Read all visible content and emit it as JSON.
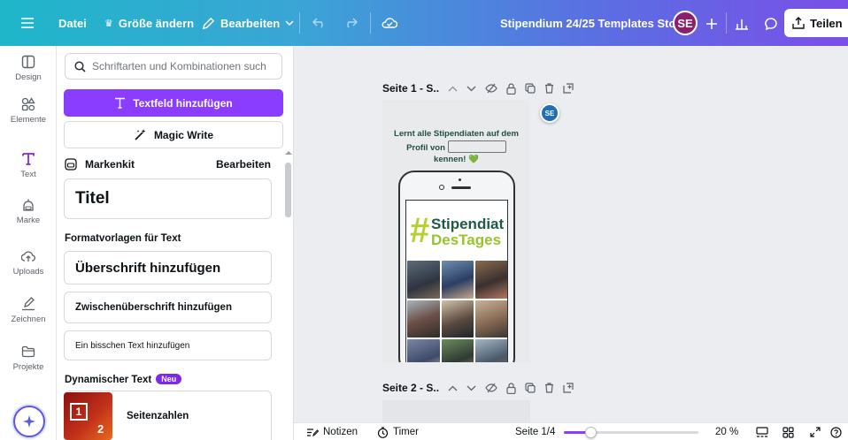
{
  "topbar": {
    "file_label": "Datei",
    "resize_label": "Größe ändern",
    "edit_label": "Bearbeiten",
    "doc_title": "Stipendium 24/25 Templates Story",
    "avatar_initials": "SE",
    "share_label": "Teilen"
  },
  "rail": {
    "items": [
      {
        "label": "Design",
        "icon": "layout-icon"
      },
      {
        "label": "Elemente",
        "icon": "shapes-icon"
      },
      {
        "label": "Text",
        "icon": "text-icon"
      },
      {
        "label": "Marke",
        "icon": "brand-icon"
      },
      {
        "label": "Uploads",
        "icon": "cloud-upload-icon"
      },
      {
        "label": "Zeichnen",
        "icon": "pen-icon"
      },
      {
        "label": "Projekte",
        "icon": "folder-icon"
      }
    ],
    "active": "Text"
  },
  "panel": {
    "search_placeholder": "Schriftarten und Kombinationen such",
    "add_textbox_label": "Textfeld hinzufügen",
    "magic_write_label": "Magic Write",
    "brandkit_label": "Markenkit",
    "brandkit_edit": "Bearbeiten",
    "title_card": "Titel",
    "format_section": "Formatvorlagen für Text",
    "heading_card": "Überschrift hinzufügen",
    "subheading_card": "Zwischenüberschrift hinzufügen",
    "body_card": "Ein bisschen Text hinzufügen",
    "dynamic_section": "Dynamischer Text",
    "new_badge": "Neu",
    "pagenum_label": "Seitenzahlen",
    "pagenum_thumb_box": "1",
    "pagenum_thumb_num": "2"
  },
  "canvas": {
    "page1_title": "Seite 1 - S..",
    "page2_title": "Seite 2 - S..",
    "float_avatar": "SE",
    "headline_1": "Lernt alle Stipendiaten auf dem",
    "headline_2": "Profil von",
    "headline_3": "kennen! 💚",
    "hashtag": "#",
    "tag_line1": "Stipendiat",
    "tag_line2": "DesTages"
  },
  "bottombar": {
    "notes_label": "Notizen",
    "timer_label": "Timer",
    "page_indicator": "Seite 1/4",
    "zoom_label": "20 %",
    "zoom_fraction": 0.2
  },
  "colors": {
    "brand_purple": "#8b3dff",
    "topbar_start": "#1fb6c9",
    "topbar_end": "#7a4fe8",
    "tag_green_dark": "#1e5a45",
    "tag_green_light": "#9ac22d"
  }
}
